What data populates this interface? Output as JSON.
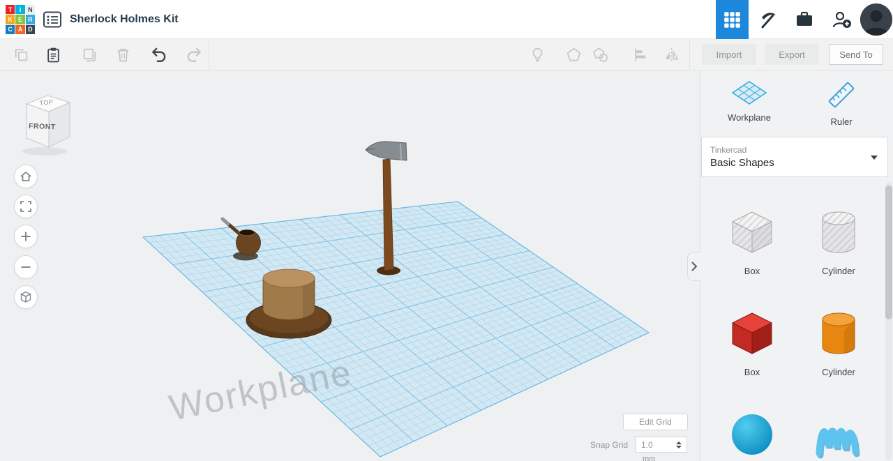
{
  "header": {
    "logo_tiles": [
      {
        "letter": "T",
        "style": "background:#e8232a;color:#ffffff"
      },
      {
        "letter": "I",
        "style": "background:#00b3e3;color:#ffffff"
      },
      {
        "letter": "N",
        "style": "background:#eceff0;color:#37474f"
      },
      {
        "letter": "K",
        "style": "background:#f9a11b;color:#ffffff"
      },
      {
        "letter": "E",
        "style": "background:#84c441;color:#ffffff"
      },
      {
        "letter": "R",
        "style": "background:#36a9e1;color:#ffffff"
      },
      {
        "letter": "C",
        "style": "background:#0d7ec1;color:#ffffff"
      },
      {
        "letter": "A",
        "style": "background:#f26522;color:#ffffff"
      },
      {
        "letter": "D",
        "style": "background:#37474f;color:#ffffff"
      }
    ],
    "title": "Sherlock Holmes Kit",
    "icons": [
      "list",
      "apps-grid",
      "pickaxe",
      "briefcase",
      "add-person",
      "avatar"
    ]
  },
  "toolbar": {
    "icons": [
      "copy",
      "paste",
      "duplicate",
      "delete",
      "undo",
      "redo",
      "lightbulb",
      "hide-shape",
      "show-shape",
      "align",
      "mirror"
    ],
    "import_label": "Import",
    "export_label": "Export",
    "send_to_label": "Send To"
  },
  "viewport": {
    "view_cube": {
      "top_label": "TOP",
      "front_label": "FRONT"
    },
    "nav_icons": [
      "home",
      "fit-view",
      "zoom-in",
      "zoom-out",
      "perspective"
    ],
    "objects": [
      "hammer",
      "pipe",
      "top-hat"
    ],
    "watermark": "Workplane",
    "edit_grid_label": "Edit Grid",
    "snap_grid_label": "Snap Grid",
    "snap_grid_value": "1.0",
    "snap_grid_unit": "mm"
  },
  "panel": {
    "workplane_label": "Workplane",
    "ruler_label": "Ruler",
    "library_brand": "Tinkercad",
    "library_name": "Basic Shapes",
    "shapes": [
      {
        "type": "box-hole",
        "label": "Box"
      },
      {
        "type": "cylinder-hole",
        "label": "Cylinder"
      },
      {
        "type": "box-solid",
        "label": "Box"
      },
      {
        "type": "cylinder-solid",
        "label": "Cylinder"
      },
      {
        "type": "sphere",
        "label": ""
      },
      {
        "type": "scribble",
        "label": ""
      }
    ]
  },
  "colors": {
    "accent_blue": "#1d87dc",
    "workplane_blue": "#45aede",
    "hole_gray": "#dcdcde",
    "solid_red": "#c22a24",
    "solid_orange": "#e8860f",
    "sphere_blue": "#16a3d8"
  }
}
